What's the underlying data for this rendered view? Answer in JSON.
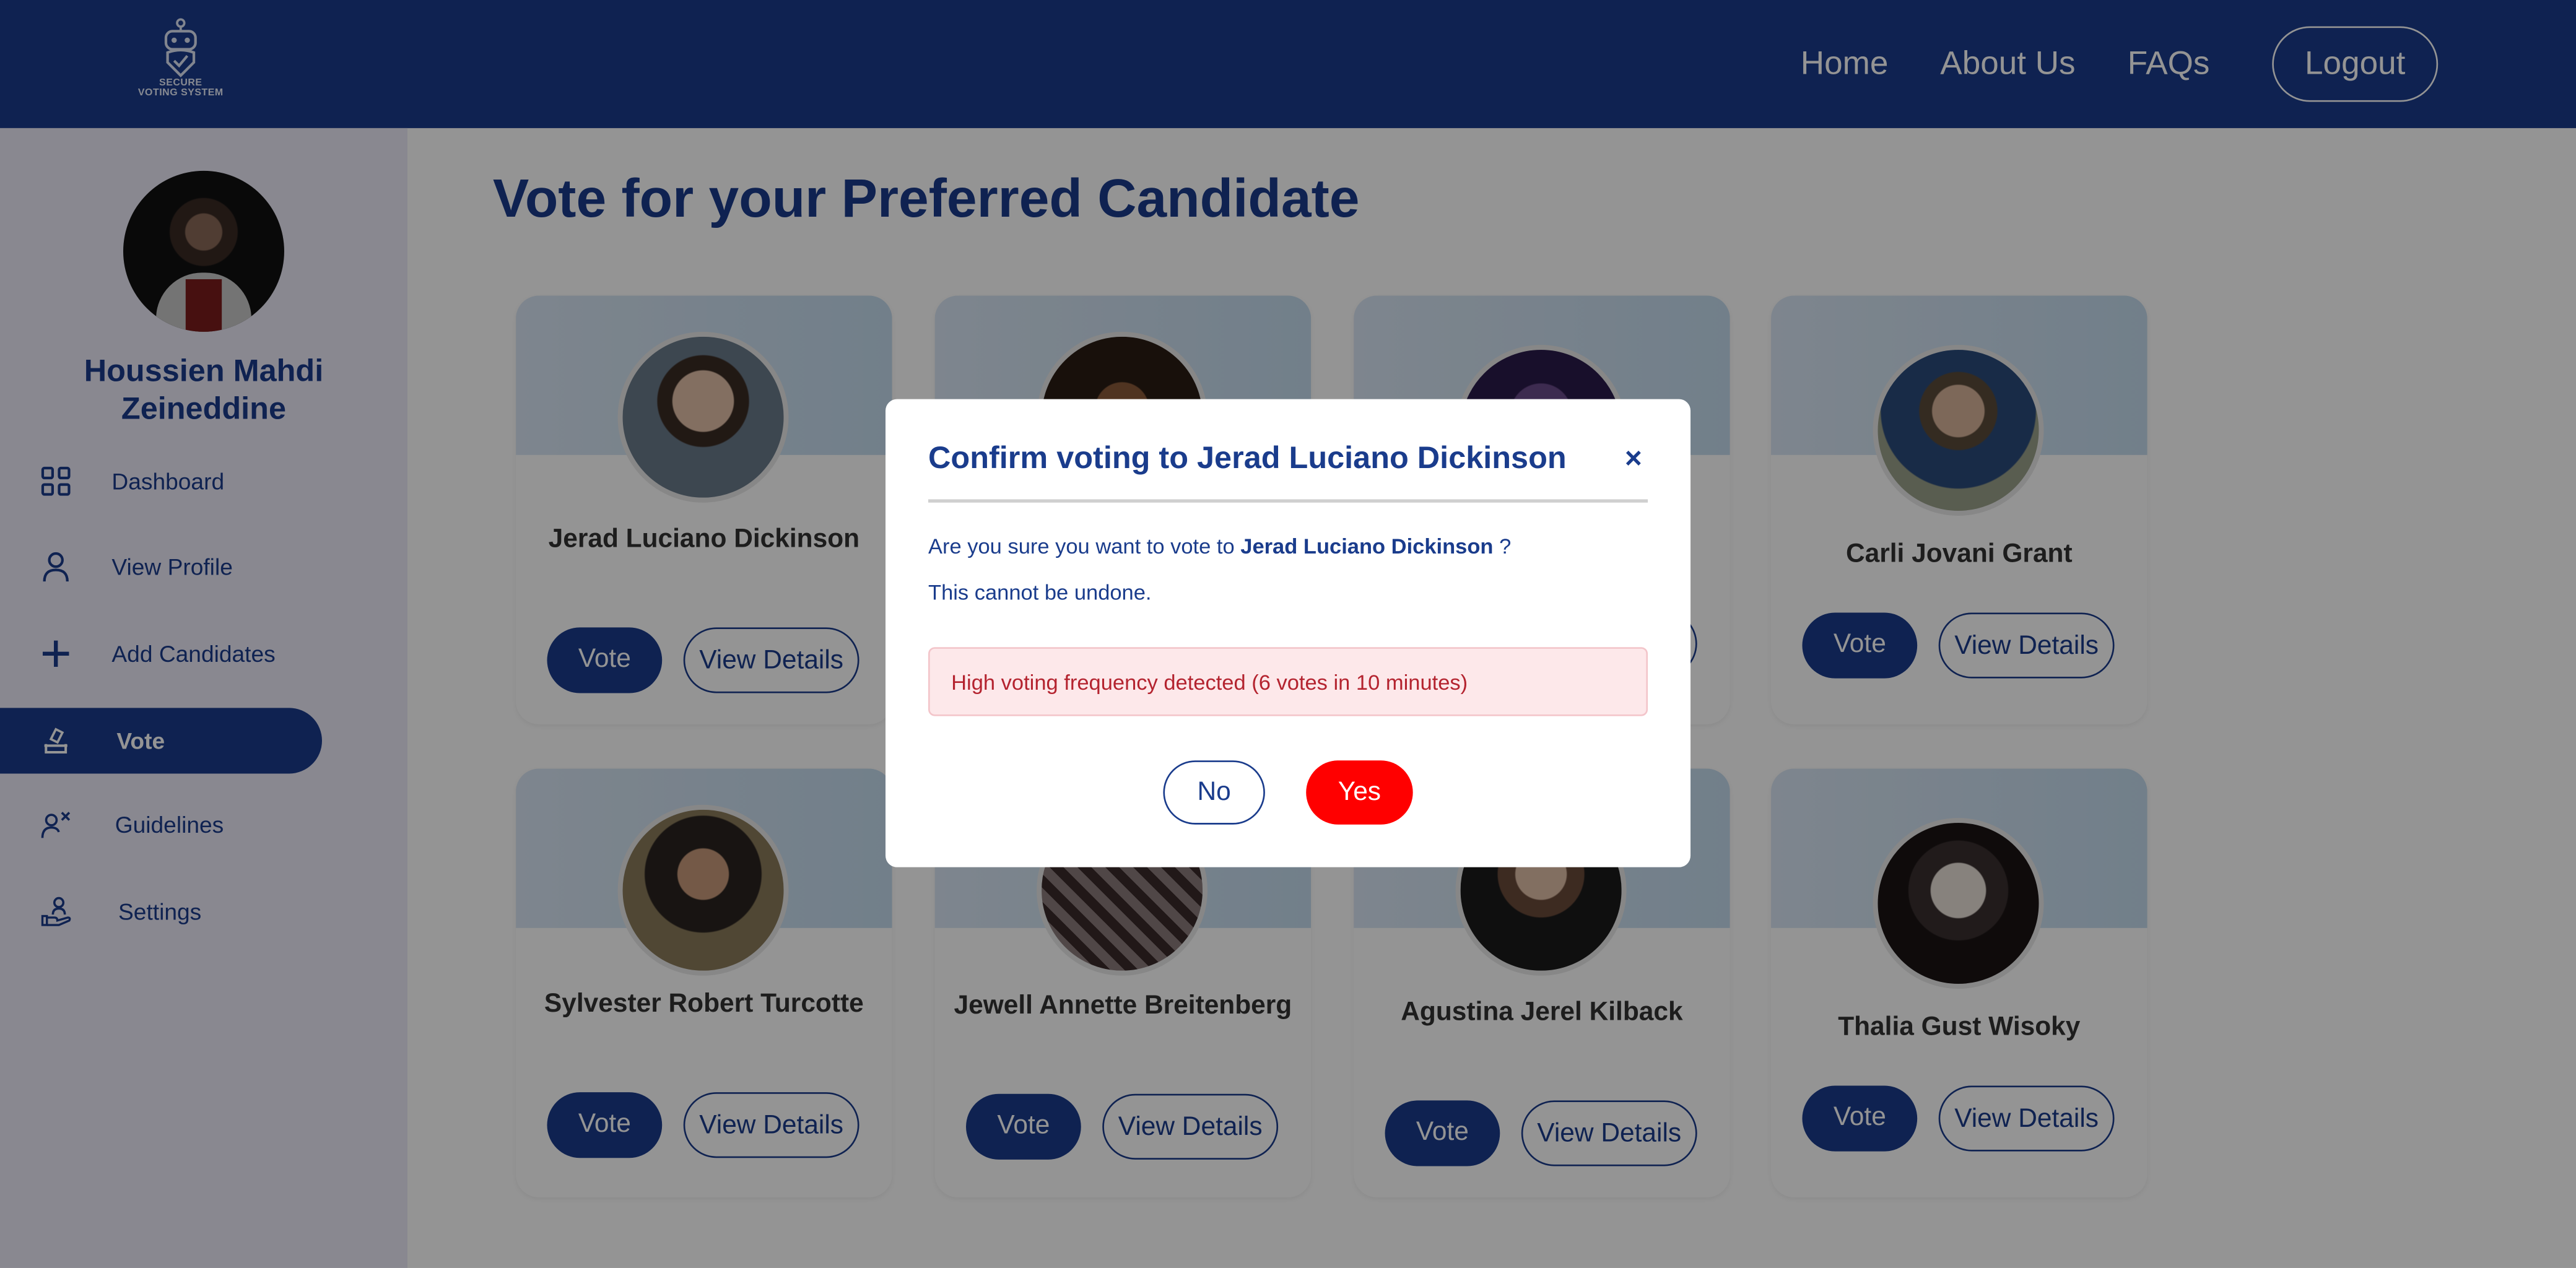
{
  "header": {
    "logo_text": "SECURE VOTING SYSTEM",
    "nav": {
      "home": "Home",
      "about": "About Us",
      "faqs": "FAQs"
    },
    "logout": "Logout"
  },
  "sidebar": {
    "user_name": "Houssien Mahdi Zeineddine",
    "items": [
      {
        "label": "Dashboard",
        "icon": "dashboard-icon"
      },
      {
        "label": "View Profile",
        "icon": "user-icon"
      },
      {
        "label": "Add Candidates",
        "icon": "plus-icon"
      },
      {
        "label": "Vote",
        "icon": "ballot-icon",
        "active": true
      },
      {
        "label": "Guidelines",
        "icon": "user-x-icon"
      },
      {
        "label": "Settings",
        "icon": "hand-user-icon"
      }
    ]
  },
  "main": {
    "title": "Vote for your Preferred Candidate",
    "vote_label": "Vote",
    "details_label": "View Details",
    "candidates": [
      {
        "name": "Jerad Luciano Dickinson"
      },
      {
        "name": ""
      },
      {
        "name": ""
      },
      {
        "name": "Carli Jovani Grant"
      },
      {
        "name": "Sylvester Robert Turcotte"
      },
      {
        "name": "Jewell Annette Breitenberg"
      },
      {
        "name": "Agustina Jerel Kilback"
      },
      {
        "name": "Thalia Gust Wisoky"
      }
    ]
  },
  "modal": {
    "title": "Confirm voting to Jerad Luciano Dickinson",
    "close": "×",
    "question_prefix": "Are you sure you want to vote to",
    "candidate": "Jerad Luciano Dickinson",
    "question_suffix": "?",
    "warning": "This cannot be undone.",
    "alert": "High voting frequency detected (6 votes in 10 minutes)",
    "no": "No",
    "yes": "Yes"
  }
}
